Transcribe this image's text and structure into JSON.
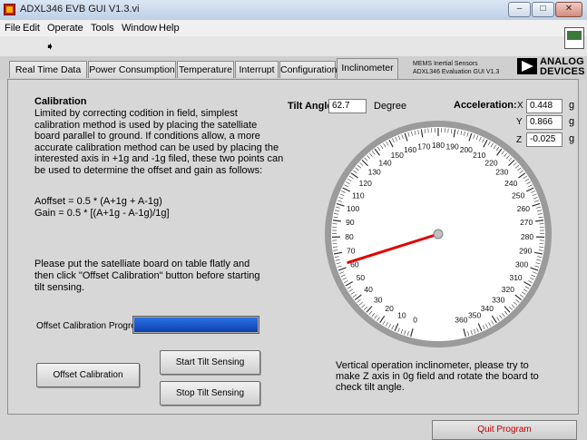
{
  "window": {
    "title": "ADXL346 EVB GUI V1.3.vi",
    "controls": {
      "minimize": "–",
      "maximize": "□",
      "close": "✕"
    }
  },
  "menu": [
    "File",
    "Edit",
    "Operate",
    "Tools",
    "Window",
    "Help"
  ],
  "toolbar": {
    "run_icon": "run-arrow-icon",
    "run_glyph": "➧"
  },
  "tabs": [
    "Real Time Data",
    "Power Consumption",
    "Temperature",
    "Interrupt",
    "Configuration",
    "Inclinometer"
  ],
  "active_tab": "Inclinometer",
  "branding": {
    "line1": "MEMS Inertial Sensors",
    "line2": "ADXL346 Evaluation GUI V1.3",
    "logo_line1": "ANALOG",
    "logo_line2": "DEVICES"
  },
  "calibration": {
    "title": "Calibration",
    "text": "Limited by correcting codition in field, simplest calibration method is used by placing the satelliate board parallel to ground. If conditions allow, a more accurate calibration method can be used by placing the interested axis in +1g and -1g filed, these two points can be used to determine the offset and gain as follows:",
    "formula_offset": "Aoffset = 0.5 * (A+1g + A-1g)",
    "formula_gain": "Gain = 0.5 * [(A+1g - A-1g)/1g]",
    "instruction": "Please put the satelliate board on table flatly and then click \"Offset Calibration\" button before starting tilt sensing.",
    "progress_label": "Offset Calibration Progress",
    "progress_percent": 100
  },
  "buttons": {
    "offset_calibration": "Offset Calibration",
    "start_tilt": "Start Tilt Sensing",
    "stop_tilt": "Stop Tilt Sensing",
    "quit": "Quit Program"
  },
  "tilt": {
    "label": "Tilt Angle:",
    "value": "62.7",
    "unit": "Degree",
    "angle": 62.7
  },
  "acceleration": {
    "label": "Acceleration:",
    "axes": [
      {
        "axis": "X",
        "value": "0.448",
        "unit": "g"
      },
      {
        "axis": "Y",
        "value": "0.866",
        "unit": "g"
      },
      {
        "axis": "Z",
        "value": "-0.025",
        "unit": "g"
      }
    ]
  },
  "gauge": {
    "min": 0,
    "max": 360,
    "major_step": 10,
    "labels": [
      "0",
      "10",
      "20",
      "30",
      "40",
      "50",
      "60",
      "70",
      "80",
      "90",
      "100",
      "110",
      "120",
      "130",
      "140",
      "150",
      "160",
      "170",
      "180",
      "190",
      "200",
      "210",
      "220",
      "230",
      "240",
      "250",
      "260",
      "270",
      "280",
      "290",
      "300",
      "310",
      "320",
      "330",
      "340",
      "350",
      "360"
    ],
    "needle_color": "#e00000"
  },
  "vertical_text": "Vertical operation inclinometer, please try to make Z axis in 0g field and rotate the board to check tilt angle."
}
